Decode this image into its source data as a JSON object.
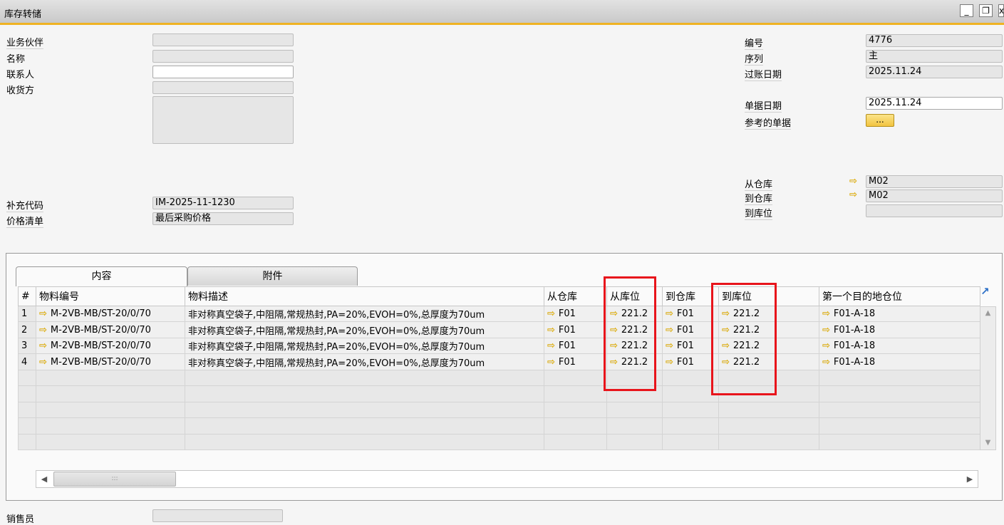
{
  "window": {
    "title": "库存转储",
    "minimize_glyph": "_",
    "maximize_glyph": "❐",
    "close_glyph": "x"
  },
  "header_left": {
    "partner_label": "业务伙伴",
    "name_label": "名称",
    "contact_label": "联系人",
    "ship_to_label": "收货方",
    "supp_code_label": "补充代码",
    "supp_code_value": "IM-2025-11-1230",
    "price_list_label": "价格清单",
    "price_list_value": "最后采购价格"
  },
  "header_right": {
    "number_label": "编号",
    "number_value": "4776",
    "series_label": "序列",
    "series_value": "主",
    "posting_date_label": "过账日期",
    "posting_date_value": "2025.11.24",
    "doc_date_label": "单据日期",
    "doc_date_value": "2025.11.24",
    "ref_doc_label": "参考的单据",
    "ref_doc_button": "...",
    "from_wh_label": "从仓库",
    "from_wh_value": "M02",
    "to_wh_label": "到仓库",
    "to_wh_value": "M02",
    "to_bin_label": "到库位"
  },
  "tabs": [
    "内容",
    "附件"
  ],
  "grid": {
    "columns": [
      "#",
      "物料编号",
      "物料描述",
      "从仓库",
      "从库位",
      "到仓库",
      "到库位",
      "第一个目的地仓位"
    ],
    "rows": [
      {
        "num": "1",
        "item": "M-2VB-MB/ST-20/0/70",
        "desc": "非对称真空袋子,中阻隔,常规热封,PA=20%,EVOH=0%,总厚度为70um",
        "from_wh": "F01",
        "from_bin": "221.2",
        "to_wh": "F01",
        "to_bin": "221.2",
        "first_dest": "F01-A-18"
      },
      {
        "num": "2",
        "item": "M-2VB-MB/ST-20/0/70",
        "desc": "非对称真空袋子,中阻隔,常规热封,PA=20%,EVOH=0%,总厚度为70um",
        "from_wh": "F01",
        "from_bin": "221.2",
        "to_wh": "F01",
        "to_bin": "221.2",
        "first_dest": "F01-A-18"
      },
      {
        "num": "3",
        "item": "M-2VB-MB/ST-20/0/70",
        "desc": "非对称真空袋子,中阻隔,常规热封,PA=20%,EVOH=0%,总厚度为70um",
        "from_wh": "F01",
        "from_bin": "221.2",
        "to_wh": "F01",
        "to_bin": "221.2",
        "first_dest": "F01-A-18"
      },
      {
        "num": "4",
        "item": "M-2VB-MB/ST-20/0/70",
        "desc": "非对称真空袋子,中阻隔,常规热封,PA=20%,EVOH=0%,总厚度为70um",
        "from_wh": "F01",
        "from_bin": "221.2",
        "to_wh": "F01",
        "to_bin": "221.2",
        "first_dest": "F01-A-18"
      }
    ]
  },
  "footer": {
    "sales_employee_label": "销售员"
  },
  "scroll": {
    "thumb_grip": ":::"
  },
  "icons": {
    "link_arrow": "⇨",
    "expand": "↗"
  },
  "colors": {
    "title_accent": "#f0b323",
    "link_arrow": "#e8b400",
    "highlight_box": "#e8141b"
  }
}
